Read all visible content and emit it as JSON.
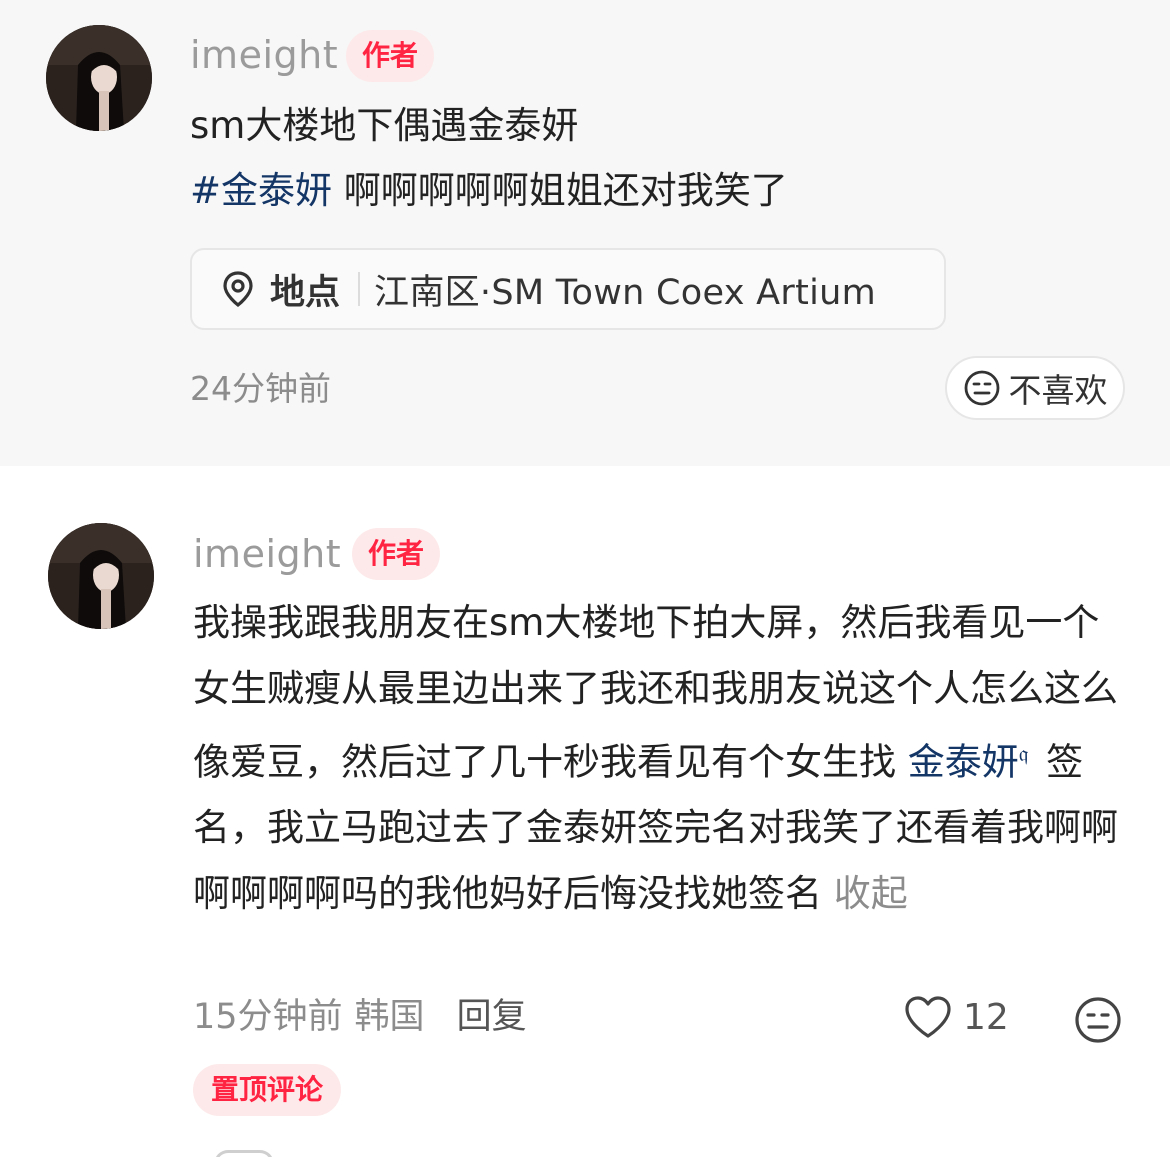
{
  "post": {
    "author": {
      "username": "imeight",
      "badge": "作者",
      "avatar_icon": "avatar-icon"
    },
    "title": "sm大楼地下偶遇金泰妍",
    "hashtag": "#金泰妍",
    "text": "啊啊啊啊啊姐姐还对我笑了",
    "location": {
      "icon": "location-pin-icon",
      "label": "地点",
      "value": "江南区·SM Town Coex Artium"
    },
    "time": "24分钟前",
    "dislike_label": "不喜欢",
    "dislike_icon": "neutral-face-icon"
  },
  "comment": {
    "author": {
      "username": "imeight",
      "badge": "作者",
      "avatar_icon": "avatar-icon"
    },
    "text_before_mention": "我操我跟我朋友在sm大楼地下拍大屏，然后我看见一个女生贼瘦从最里边出来了我还和我朋友说这个人怎么这么像爱豆，然后过了几十秒我看见有个女生找 ",
    "mention": "金泰妍",
    "mention_icon": "search-icon",
    "text_after_mention": " 签名，我立马跑过去了金泰妍签完名对我笑了还看着我啊啊啊啊啊啊吗的我他妈好后悔没找她签名 ",
    "collapse_label": "收起",
    "time": "15分钟前",
    "region": "韩国",
    "reply_label": "回复",
    "like_icon": "heart-icon",
    "like_count": "12",
    "dislike_icon": "neutral-face-icon",
    "pinned_label": "置顶评论"
  },
  "colors": {
    "accent_red": "#ff2442",
    "badge_bg": "#fde9ea",
    "link_blue": "#133667",
    "muted_text": "#8c8c8c",
    "post_bg": "#f7f7f7"
  }
}
